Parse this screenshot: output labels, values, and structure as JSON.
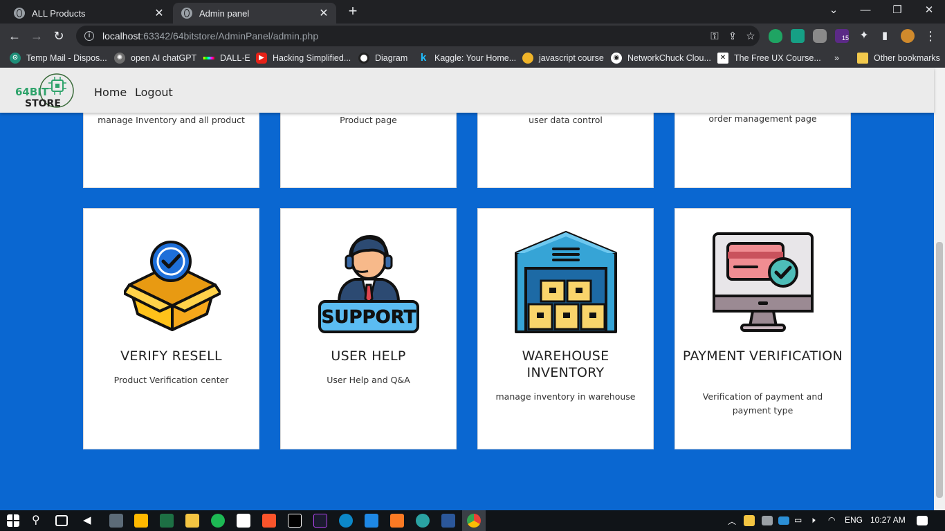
{
  "browser": {
    "tabs": [
      {
        "title": "ALL Products"
      },
      {
        "title": "Admin panel"
      }
    ],
    "url": {
      "host": "localhost",
      "rest": ":63342/64bitstore/AdminPanel/admin.php"
    },
    "bookmarks": [
      "Temp Mail - Dispos...",
      "open AI chatGPT",
      "DALL·E",
      "Hacking Simplified...",
      "Diagram",
      "Kaggle: Your Home...",
      "javascript course",
      "NetworkChuck Clou...",
      "The Free UX Course...",
      "Other bookmarks"
    ],
    "extension_badge": "15"
  },
  "site": {
    "logo_text": "64BIT STORE",
    "nav": {
      "home": "Home",
      "logout": "Logout"
    }
  },
  "cards_top": [
    {
      "desc": "manage Inventory and all product"
    },
    {
      "desc": "Product page"
    },
    {
      "desc": "user data control"
    },
    {
      "desc": "order management page"
    }
  ],
  "cards_bottom": [
    {
      "title": "VERIFY RESELL",
      "desc": "Product Verification center",
      "icon": "verified-box-icon"
    },
    {
      "title": "USER HELP",
      "desc": "User Help and Q&A",
      "icon": "support-agent-icon"
    },
    {
      "title": "WAREHOUSE INVENTORY",
      "desc": "manage inventory in warehouse",
      "icon": "warehouse-icon"
    },
    {
      "title": "PAYMENT VERIFICATION",
      "desc": "Verification of payment and payment type",
      "icon": "payment-monitor-icon"
    }
  ],
  "support_text": "SUPPORT",
  "taskbar": {
    "lang": "ENG",
    "time": "10:27 AM"
  },
  "colors": {
    "page_bg": "#0a67d1",
    "nav_bg": "#ebebeb",
    "card_bg": "#ffffff"
  }
}
